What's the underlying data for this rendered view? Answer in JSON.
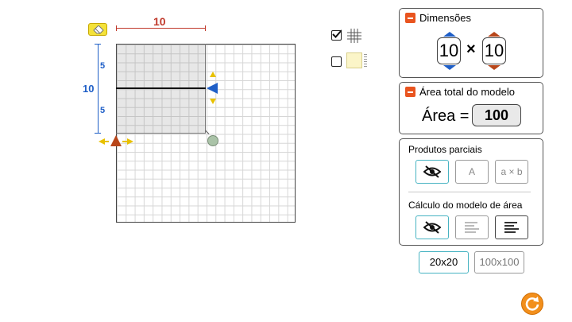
{
  "workspace": {
    "top_dimension": "10",
    "left_total": "10",
    "left_top_part": "5",
    "left_bottom_part": "5"
  },
  "options": {
    "show_grid_checked": true,
    "paper_checked": false
  },
  "dimensions_panel": {
    "title": "Dimensões",
    "rows_value": "10",
    "times_symbol": "×",
    "cols_value": "10"
  },
  "area_panel": {
    "title": "Área total do modelo",
    "label": "Área =",
    "value": "100"
  },
  "partial_panel": {
    "title": "Produtos parciais",
    "btn_a": "A",
    "btn_axb": "a × b",
    "calc_title": "Cálculo do modelo de área"
  },
  "grid_size": {
    "option_1": "20x20",
    "option_2": "100x100",
    "selected": "20x20"
  },
  "colors": {
    "accent_orange": "#e9541f",
    "selected_teal": "#47b3c2",
    "blue": "#1f5fc7",
    "red": "#c0392b"
  }
}
